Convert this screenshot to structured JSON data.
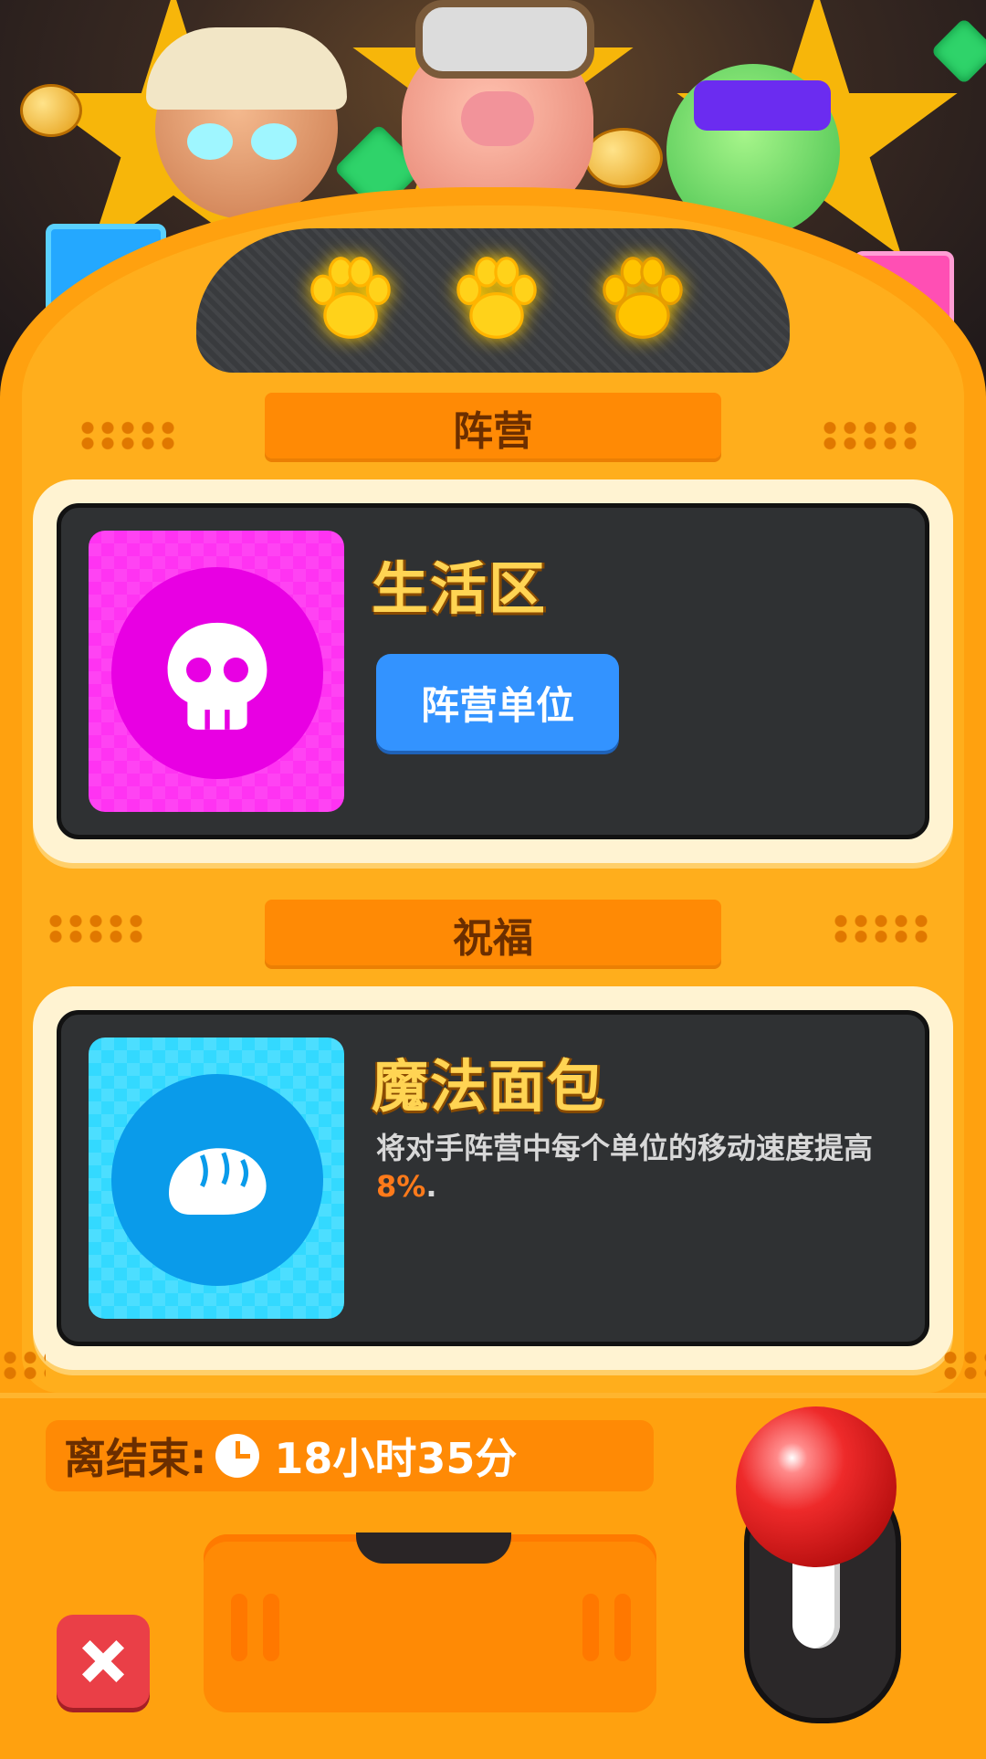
{
  "faction": {
    "header": "阵营",
    "name": "生活区",
    "button_label": "阵营单位",
    "icon": "skull-icon"
  },
  "blessing": {
    "header": "祝福",
    "name": "魔法面包",
    "description_prefix": "将对手阵营中每个单位的移动速度提高 ",
    "description_value": "8%",
    "description_suffix": ".",
    "icon": "bread-icon"
  },
  "timer": {
    "label": "离结束:",
    "value": "18小时35分"
  },
  "paws": {
    "count": 3,
    "icon": "paw-icon"
  },
  "controls": {
    "close_icon": "close-icon",
    "lever_icon": "lever"
  },
  "colors": {
    "machine": "#ffa10f",
    "label_bar": "#ff8a05",
    "faction_tile": "#ff33f2",
    "blessing_tile": "#33d9ff",
    "button_blue": "#3393ff",
    "title_gold": "#ffd453",
    "highlight": "#ff7a1a",
    "close_red": "#ea3f47"
  }
}
